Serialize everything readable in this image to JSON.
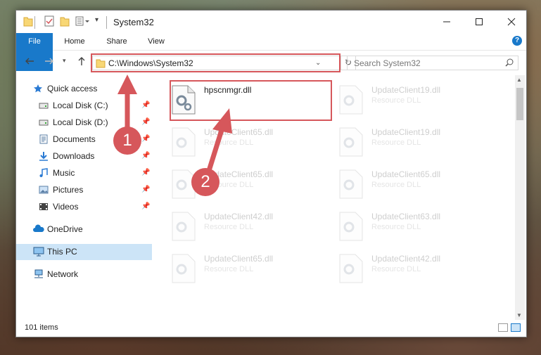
{
  "window": {
    "title": "System32"
  },
  "ribbon": {
    "tabs": [
      "File",
      "Home",
      "Share",
      "View"
    ],
    "help": "?"
  },
  "address": {
    "path": "C:\\Windows\\System32",
    "search_placeholder": "Search System32"
  },
  "sidebar": {
    "items": [
      {
        "label": "Quick access",
        "icon": "star-icon",
        "pinned": false
      },
      {
        "label": "Local Disk (C:)",
        "icon": "drive-icon",
        "pinned": true
      },
      {
        "label": "Local Disk (D:)",
        "icon": "drive-icon",
        "pinned": true
      },
      {
        "label": "Documents",
        "icon": "documents-icon",
        "pinned": true
      },
      {
        "label": "Downloads",
        "icon": "downloads-icon",
        "pinned": true
      },
      {
        "label": "Music",
        "icon": "music-icon",
        "pinned": true
      },
      {
        "label": "Pictures",
        "icon": "pictures-icon",
        "pinned": true
      },
      {
        "label": "Videos",
        "icon": "videos-icon",
        "pinned": true
      },
      {
        "label": "OneDrive",
        "icon": "onedrive-icon",
        "pinned": false
      },
      {
        "label": "This PC",
        "icon": "computer-icon",
        "pinned": false
      },
      {
        "label": "Network",
        "icon": "network-icon",
        "pinned": false
      }
    ]
  },
  "files": [
    {
      "name": "hpscnmgr.dll",
      "type": "",
      "highlighted": true
    },
    {
      "name": "UpdateClient19.dll",
      "type": "Resource DLL"
    },
    {
      "name": "UpdateClient65.dll",
      "type": "Resource DLL"
    },
    {
      "name": "UpdateClient19.dll",
      "type": "Resource DLL"
    },
    {
      "name": "UpdateClient65.dll",
      "type": "Resource DLL"
    },
    {
      "name": "UpdateClient65.dll",
      "type": "Resource DLL"
    },
    {
      "name": "UpdateClient42.dll",
      "type": "Resource DLL"
    },
    {
      "name": "UpdateClient63.dll",
      "type": "Resource DLL"
    },
    {
      "name": "UpdateClient65.dll",
      "type": "Resource DLL"
    },
    {
      "name": "UpdateClient42.dll",
      "type": "Resource DLL"
    }
  ],
  "status": {
    "count": "101 items"
  },
  "annotations": {
    "step1": "1",
    "step2": "2"
  },
  "colors": {
    "accent": "#1979ca",
    "annotation": "#d6575b",
    "folder": "#f8d775"
  }
}
